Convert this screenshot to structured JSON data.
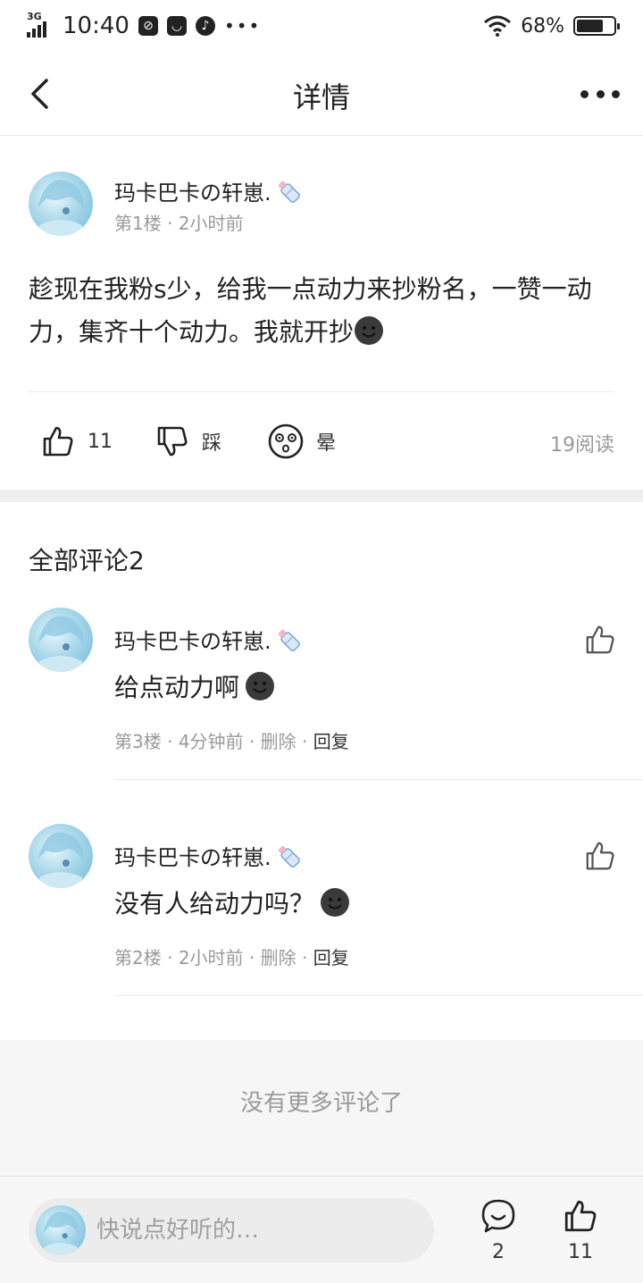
{
  "status_bar": {
    "network": "3G",
    "time": "10:40",
    "battery": "68%",
    "battery_level": 0.68,
    "icons": [
      "3g-signal-icon",
      "no-disturb-icon",
      "taobao-icon",
      "music-icon",
      "more-dots-icon",
      "wifi-icon",
      "battery-icon"
    ]
  },
  "header": {
    "title": "详情",
    "back_icon": "chevron-left-icon",
    "more_icon": "more-dots-icon"
  },
  "post": {
    "username": "玛卡巴卡の轩崽.",
    "badge_icon": "baby-bottle-icon",
    "meta": "第1楼 · 2小时前",
    "content": "趁现在我粉s少，给我一点动力来抄粉名，一赞一动力，集齐十个动力。我就开抄",
    "content_emoji": "smiling-face-icon",
    "like_count": "11",
    "dislike_label": "踩",
    "dizzy_label": "晕",
    "read_count": "19阅读"
  },
  "comments_header": "全部评论2",
  "comments": [
    {
      "username": "玛卡巴卡の轩崽.",
      "text": "给点动力啊",
      "floor": "第3楼",
      "time": "4分钟前",
      "delete_label": "删除",
      "reply_label": "回复"
    },
    {
      "username": "玛卡巴卡の轩崽.",
      "text": "没有人给动力吗？",
      "floor": "第2楼",
      "time": "2小时前",
      "delete_label": "删除",
      "reply_label": "回复"
    }
  ],
  "no_more_text": "没有更多评论了",
  "bottom_bar": {
    "input_placeholder": "快说点好听的…",
    "comment_count": "2",
    "like_count": "11"
  },
  "colors": {
    "text_primary": "#222222",
    "text_secondary": "#9a9a9a",
    "divider": "#ececec",
    "band": "#efefef"
  }
}
